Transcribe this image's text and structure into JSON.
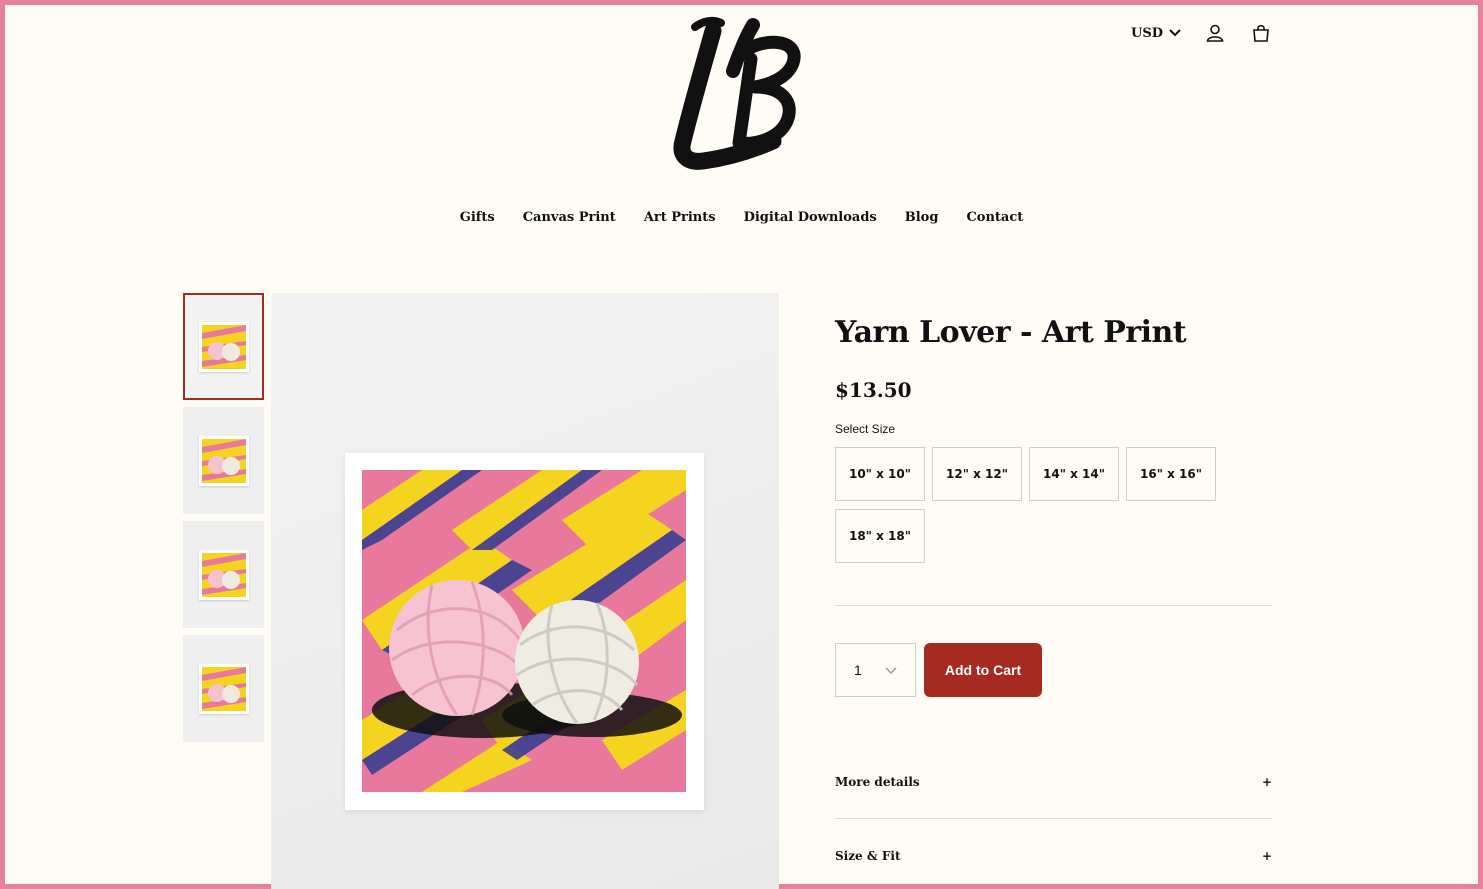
{
  "header": {
    "brand_logo_text": "LB",
    "currency": "USD"
  },
  "nav": {
    "items": [
      "Gifts",
      "Canvas Print",
      "Art Prints",
      "Digital Downloads",
      "Blog",
      "Contact"
    ]
  },
  "product": {
    "title": "Yarn Lover - Art Print",
    "price": "$13.50",
    "size_label": "Select Size",
    "sizes": [
      "10\" x 10\"",
      "12\" x 12\"",
      "14\" x 14\"",
      "16\" x 16\"",
      "18\" x 18\""
    ],
    "quantity": "1",
    "add_to_cart": "Add to Cart",
    "accordions": [
      "More details",
      "Size & Fit"
    ],
    "accordion_icon": "+"
  },
  "colors": {
    "page_border": "#e8819c",
    "background": "#fffcf5",
    "accent": "#a52a1f"
  }
}
